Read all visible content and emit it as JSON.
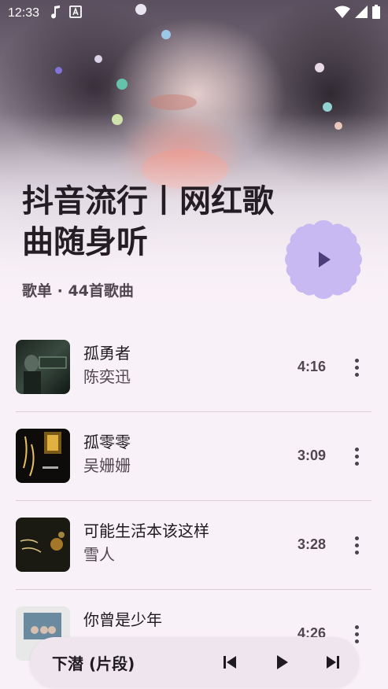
{
  "status_bar": {
    "time": "12:33",
    "icons": [
      "music-note-icon",
      "font-a-icon",
      "wifi-icon",
      "signal-icon",
      "battery-icon"
    ]
  },
  "playlist": {
    "title": "抖音流行丨网红歌曲随身听",
    "meta": "歌单 · 44首歌曲"
  },
  "songs": [
    {
      "title": "孤勇者",
      "artist": "陈奕迅",
      "duration": "4:16"
    },
    {
      "title": "孤零零",
      "artist": "吴姗姗",
      "duration": "3:09"
    },
    {
      "title": "可能生活本该这样",
      "artist": "雪人",
      "duration": "3:28"
    },
    {
      "title": "你曾是少年",
      "artist": "",
      "duration": "4:26"
    }
  ],
  "mini_player": {
    "title": "下潜 (片段)"
  },
  "colors": {
    "background": "#f8f1f7",
    "fab": "#c9b9f2",
    "fab_icon": "#4b3e7a",
    "mini_player": "#eee5ee"
  }
}
